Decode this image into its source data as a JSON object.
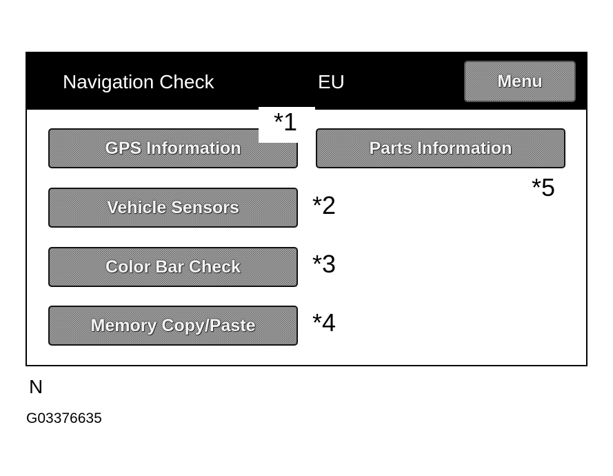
{
  "header": {
    "title": "Navigation Check",
    "region": "EU",
    "menu_label": "Menu"
  },
  "buttons": {
    "gps": "GPS Information",
    "parts": "Parts Information",
    "vehicle_sensors": "Vehicle Sensors",
    "color_bar": "Color Bar Check",
    "memory": "Memory Copy/Paste"
  },
  "markers": {
    "m1": "*1",
    "m2": "*2",
    "m3": "*3",
    "m4": "*4",
    "m5": "*5"
  },
  "captions": {
    "label": "N",
    "figure_code": "G03376635"
  },
  "colors": {
    "header_bg": "#000000",
    "button_fill": "#c4c4c4",
    "text": "#000000"
  }
}
